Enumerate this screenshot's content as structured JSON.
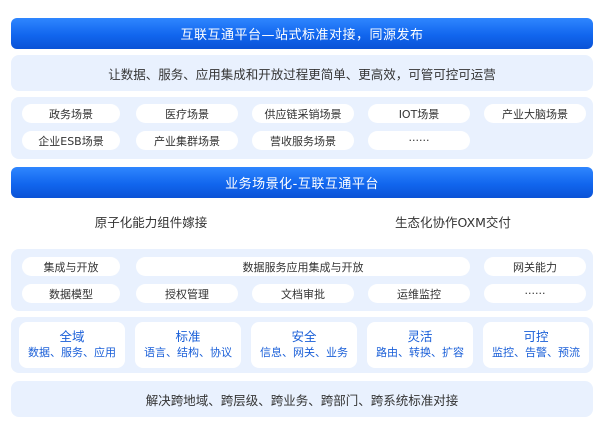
{
  "header": {
    "title": "互联互通平台—站式标准对接，同源发布"
  },
  "slogan": "让数据、服务、应用集成和开放过程更简单、更高效，可管可控可运营",
  "scenes": {
    "row1": [
      "政务场景",
      "医疗场景",
      "供应链采销场景",
      "IOT场景",
      "产业大脑场景"
    ],
    "row2": [
      "企业ESB场景",
      "产业集群场景",
      "营收服务场景",
      "······"
    ]
  },
  "middle_bar": {
    "title": "业务场景化-互联互通平台"
  },
  "capabilities": {
    "left": "原子化能力组件嫁接",
    "right": "生态化协作OXM交付"
  },
  "functions": {
    "integration": "集成与开放",
    "data_service": "数据服务应用集成与开放",
    "gateway": "网关能力",
    "data_model": "数据模型",
    "auth": "授权管理",
    "doc_review": "文档审批",
    "ops_monitor": "运维监控",
    "more": "······"
  },
  "features": [
    {
      "title": "全域",
      "sub": "数据、服务、应用"
    },
    {
      "title": "标准",
      "sub": "语言、结构、协议"
    },
    {
      "title": "安全",
      "sub": "信息、网关、业务"
    },
    {
      "title": "灵活",
      "sub": "路由、转换、扩容"
    },
    {
      "title": "可控",
      "sub": "监控、告警、预流"
    }
  ],
  "footer": "解决跨地域、跨层级、跨业务、跨部门、跨系统标准对接"
}
